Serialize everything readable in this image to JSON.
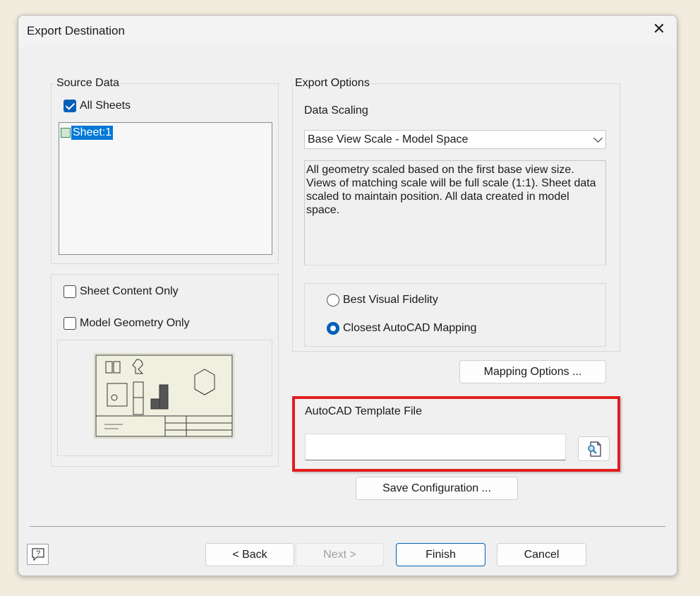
{
  "dialog": {
    "title": "Export Destination",
    "close_icon": "close-icon"
  },
  "source_data": {
    "group_label": "Source Data",
    "all_sheets_label": "All Sheets",
    "all_sheets_checked": true,
    "sheets": [
      "Sheet:1"
    ],
    "sheet_content_only_label": "Sheet Content Only",
    "model_geometry_only_label": "Model Geometry Only"
  },
  "export_options": {
    "group_label": "Export Options",
    "data_scaling_label": "Data Scaling",
    "data_scaling_value": "Base View Scale - Model Space",
    "description": "All geometry scaled based on the first base view size. Views of matching scale will be full scale (1:1). Sheet data scaled to maintain position. All data created in model space.",
    "best_visual_fidelity_label": "Best Visual Fidelity",
    "closest_autocad_mapping_label": "Closest AutoCAD Mapping",
    "selected_mapping": "Closest AutoCAD Mapping",
    "mapping_options_label": "Mapping Options ..."
  },
  "template": {
    "label": "AutoCAD Template File",
    "value": "",
    "browse_icon": "browse-file-icon"
  },
  "save_configuration_label": "Save Configuration ...",
  "footer": {
    "help_icon": "help-icon",
    "back_label": "< Back",
    "next_label": "Next >",
    "finish_label": "Finish",
    "cancel_label": "Cancel"
  },
  "colors": {
    "highlight": "#e01e1e",
    "accent": "#005fb8",
    "selection": "#0078d7"
  }
}
